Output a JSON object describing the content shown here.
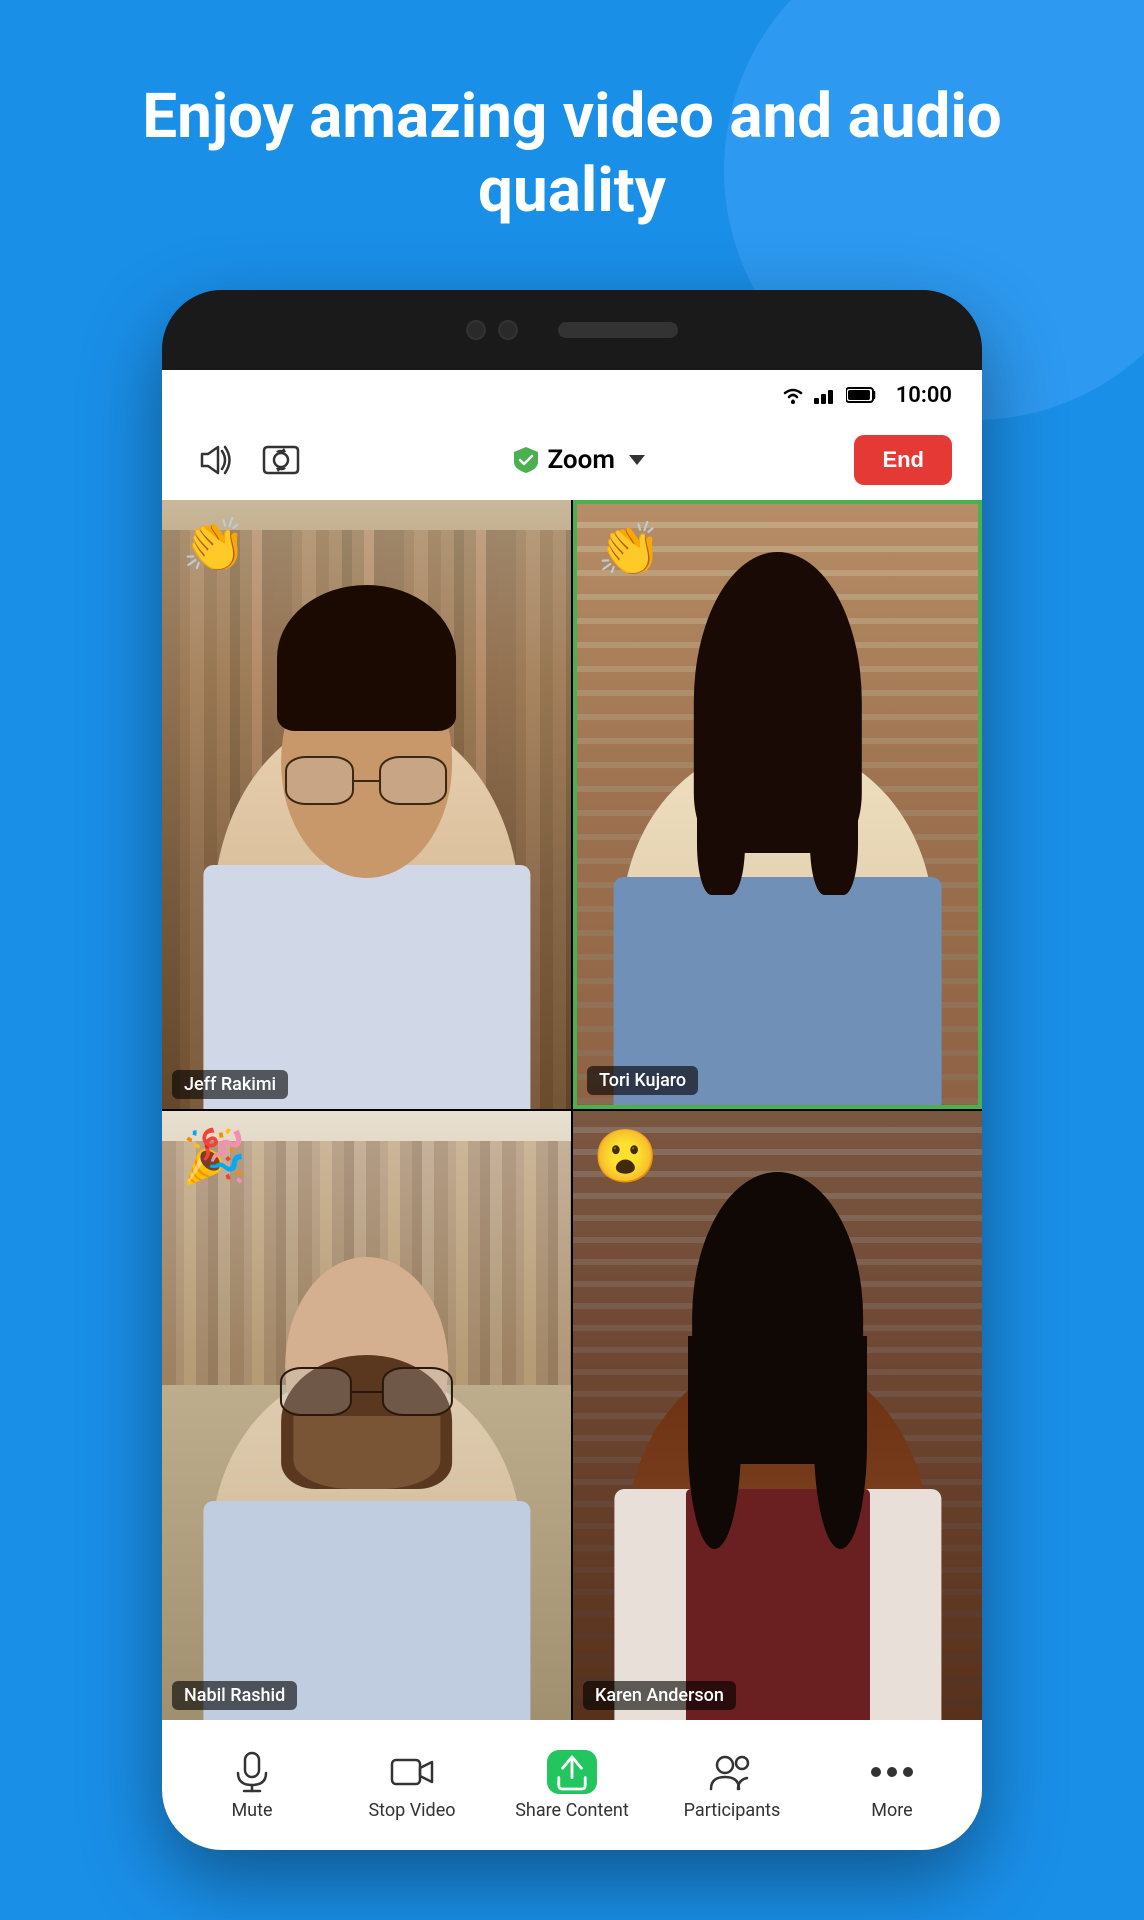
{
  "page": {
    "background_color": "#1a8fe8"
  },
  "hero": {
    "title": "Enjoy amazing video and audio quality"
  },
  "status_bar": {
    "time": "10:00",
    "wifi": true,
    "signal": true,
    "battery": true
  },
  "zoom_toolbar": {
    "speaker_icon": "speaker",
    "camera_flip_icon": "camera-flip",
    "brand_name": "Zoom",
    "end_button_label": "End"
  },
  "video_grid": {
    "participants": [
      {
        "id": "jeff",
        "name": "Jeff Rakimi",
        "emoji": "👏",
        "emoji_position": "top-left",
        "active_speaker": false
      },
      {
        "id": "tori",
        "name": "Tori Kujaro",
        "emoji": "👏",
        "emoji_position": "top-left",
        "active_speaker": true
      },
      {
        "id": "nabil",
        "name": "Nabil Rashid",
        "emoji": "🎉",
        "emoji_position": "top-left",
        "active_speaker": false
      },
      {
        "id": "karen",
        "name": "Karen Anderson",
        "emoji": "😮",
        "emoji_position": "top-left",
        "active_speaker": false
      }
    ]
  },
  "bottom_nav": {
    "items": [
      {
        "id": "mute",
        "label": "Mute",
        "icon": "microphone"
      },
      {
        "id": "stop-video",
        "label": "Stop Video",
        "icon": "video-camera"
      },
      {
        "id": "share-content",
        "label": "Share Content",
        "icon": "share-arrow"
      },
      {
        "id": "participants",
        "label": "Participants",
        "icon": "people"
      },
      {
        "id": "more",
        "label": "More",
        "icon": "dots"
      }
    ]
  }
}
